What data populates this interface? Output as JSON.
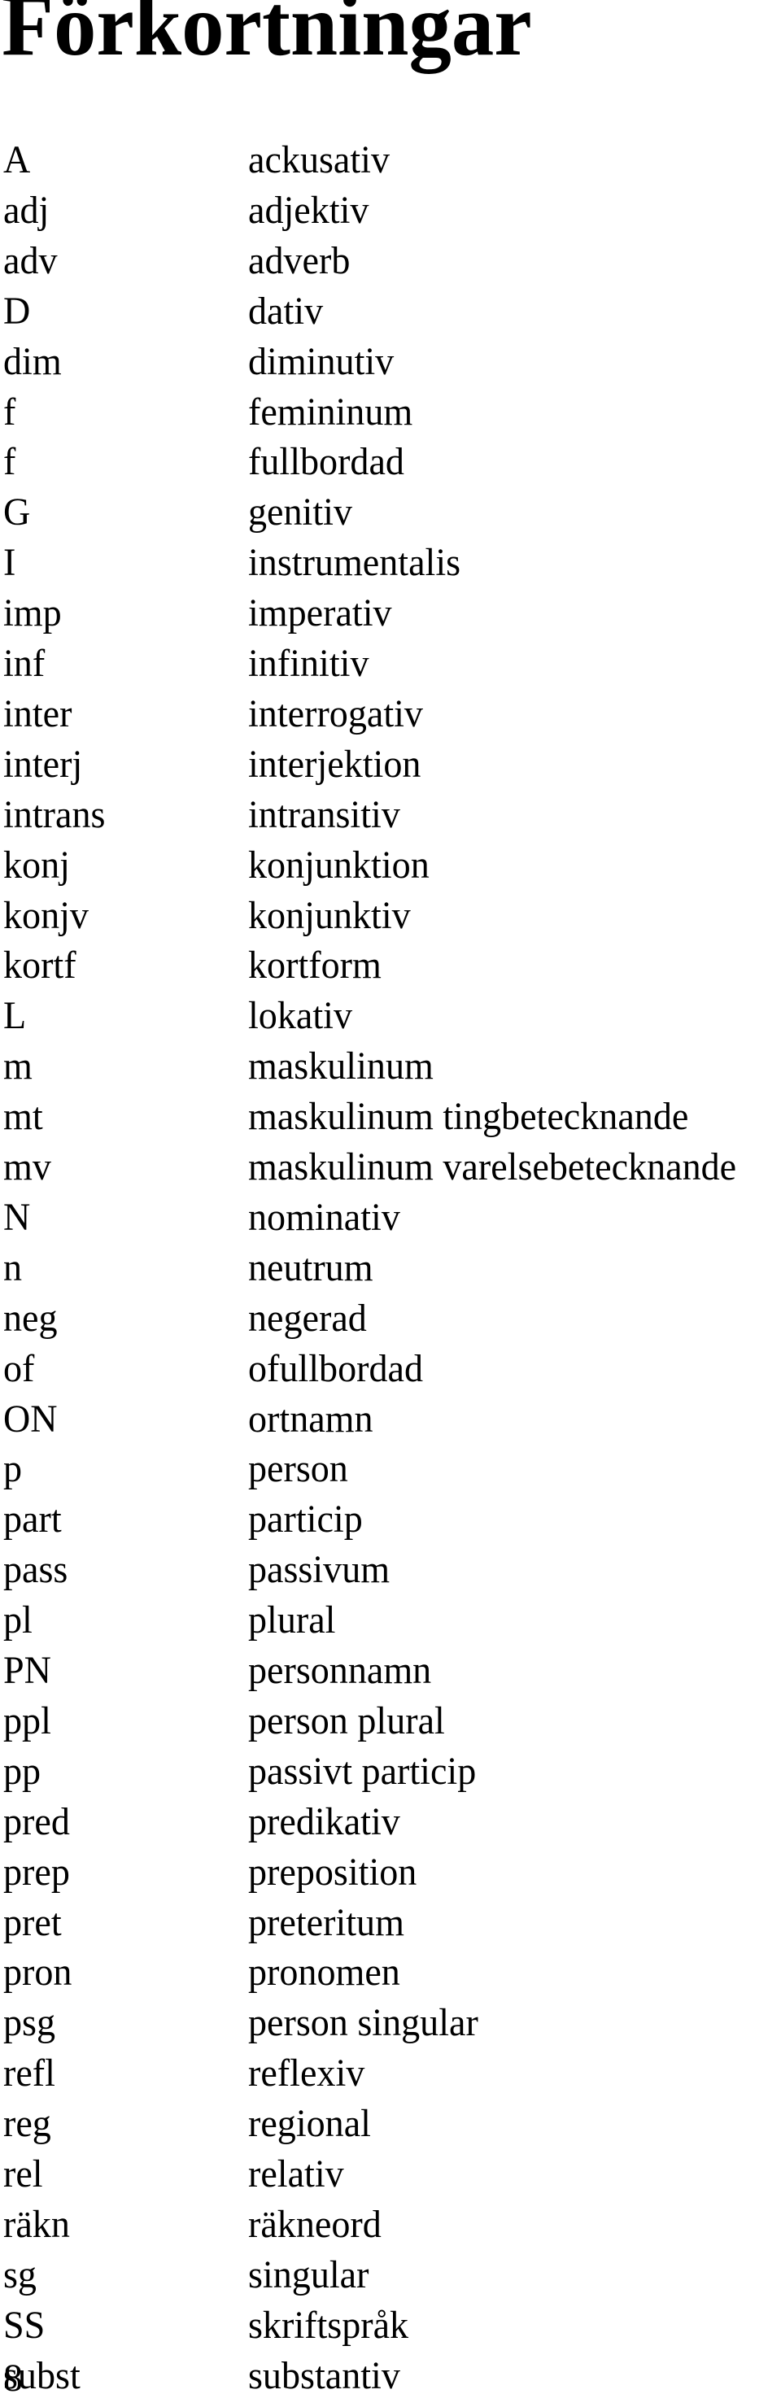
{
  "title": "Förkortningar",
  "entries": [
    {
      "abbr": "A",
      "meaning": "ackusativ"
    },
    {
      "abbr": "adj",
      "meaning": "adjektiv"
    },
    {
      "abbr": "adv",
      "meaning": "adverb"
    },
    {
      "abbr": "D",
      "meaning": "dativ"
    },
    {
      "abbr": "dim",
      "meaning": "diminutiv"
    },
    {
      "abbr": "f",
      "meaning": "femininum"
    },
    {
      "abbr": "f",
      "meaning": "fullbordad"
    },
    {
      "abbr": "G",
      "meaning": "genitiv"
    },
    {
      "abbr": "I",
      "meaning": "instrumentalis"
    },
    {
      "abbr": "imp",
      "meaning": "imperativ"
    },
    {
      "abbr": "inf",
      "meaning": "infinitiv"
    },
    {
      "abbr": "inter",
      "meaning": "interrogativ"
    },
    {
      "abbr": "interj",
      "meaning": "interjektion"
    },
    {
      "abbr": "intrans",
      "meaning": "intransitiv"
    },
    {
      "abbr": "konj",
      "meaning": "konjunktion"
    },
    {
      "abbr": "konjv",
      "meaning": "konjunktiv"
    },
    {
      "abbr": "kortf",
      "meaning": "kortform"
    },
    {
      "abbr": "L",
      "meaning": "lokativ"
    },
    {
      "abbr": "m",
      "meaning": "maskulinum"
    },
    {
      "abbr": "mt",
      "meaning": "maskulinum tingbetecknande"
    },
    {
      "abbr": "mv",
      "meaning": "maskulinum varelsebetecknande"
    },
    {
      "abbr": "N",
      "meaning": "nominativ"
    },
    {
      "abbr": "n",
      "meaning": "neutrum"
    },
    {
      "abbr": "neg",
      "meaning": "negerad"
    },
    {
      "abbr": "of",
      "meaning": "ofullbordad"
    },
    {
      "abbr": "ON",
      "meaning": "ortnamn"
    },
    {
      "abbr": "p",
      "meaning": "person"
    },
    {
      "abbr": "part",
      "meaning": "particip"
    },
    {
      "abbr": "pass",
      "meaning": "passivum"
    },
    {
      "abbr": "pl",
      "meaning": "plural"
    },
    {
      "abbr": "PN",
      "meaning": "personnamn"
    },
    {
      "abbr": "ppl",
      "meaning": "person plural"
    },
    {
      "abbr": "pp",
      "meaning": "passivt particip"
    },
    {
      "abbr": "pred",
      "meaning": "predikativ"
    },
    {
      "abbr": "prep",
      "meaning": "preposition"
    },
    {
      "abbr": "pret",
      "meaning": "preteritum"
    },
    {
      "abbr": "pron",
      "meaning": "pronomen"
    },
    {
      "abbr": "psg",
      "meaning": "person singular"
    },
    {
      "abbr": "refl",
      "meaning": "reflexiv"
    },
    {
      "abbr": "reg",
      "meaning": "regional"
    },
    {
      "abbr": "rel",
      "meaning": "relativ"
    },
    {
      "abbr": "räkn",
      "meaning": "räkneord"
    },
    {
      "abbr": "sg",
      "meaning": "singular"
    },
    {
      "abbr": "SS",
      "meaning": "skriftspråk"
    },
    {
      "abbr": "subst",
      "meaning": "substantiv"
    }
  ],
  "page_number": "8"
}
